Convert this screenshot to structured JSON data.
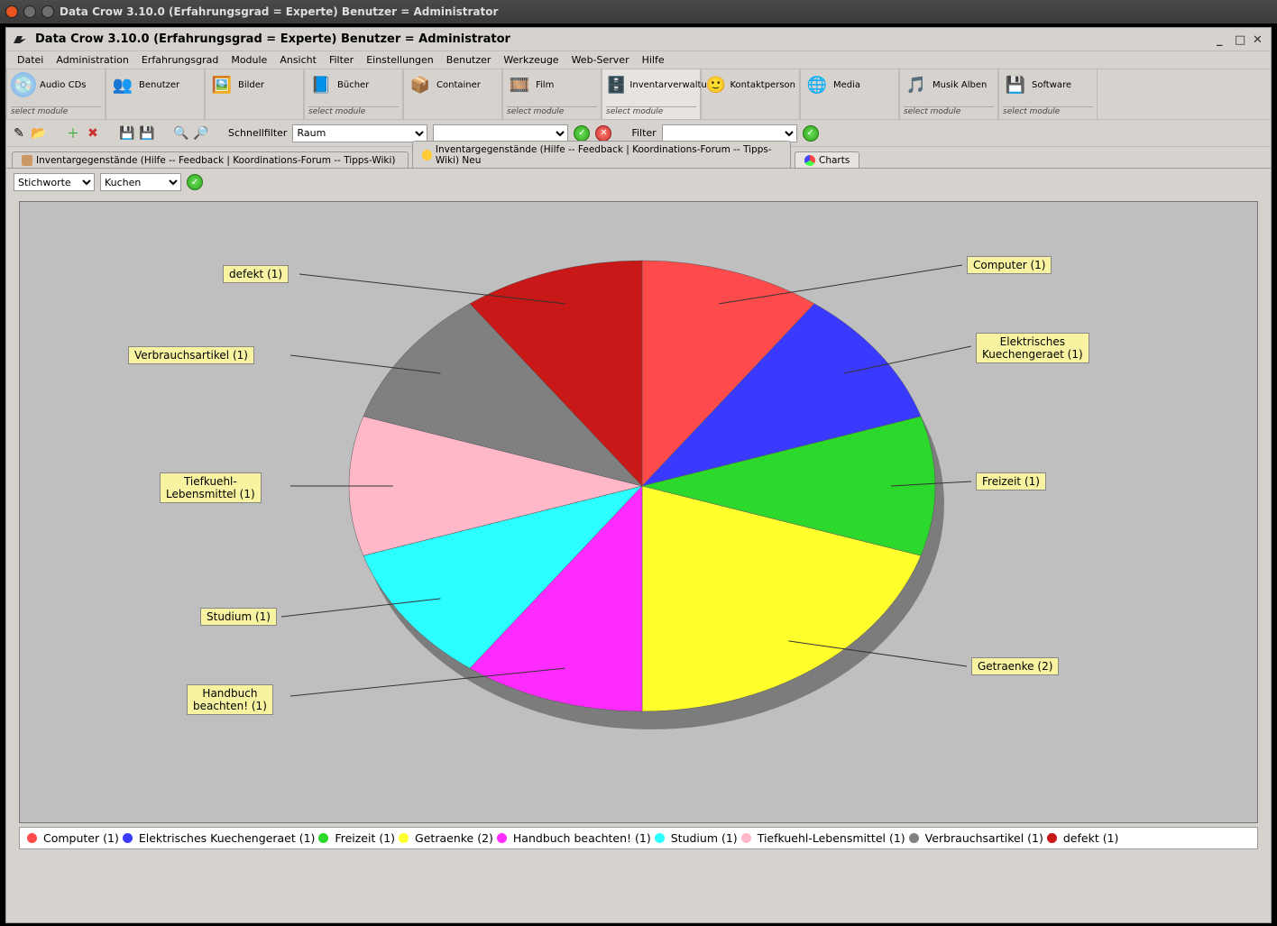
{
  "outer_title": "Data Crow 3.10.0    (Erfahrungsgrad = Experte)   Benutzer = Administrator",
  "inner_title": "Data Crow 3.10.0    (Erfahrungsgrad = Experte)   Benutzer = Administrator",
  "menu": {
    "datei": "Datei",
    "administration": "Administration",
    "erfahrungsgrad": "Erfahrungsgrad",
    "module": "Module",
    "ansicht": "Ansicht",
    "filter": "Filter",
    "einstellungen": "Einstellungen",
    "benutzer": "Benutzer",
    "werkzeuge": "Werkzeuge",
    "webserver": "Web-Server",
    "hilfe": "Hilfe"
  },
  "modules": {
    "select_module": "select module",
    "items": [
      {
        "label": "Audio CDs",
        "select": true
      },
      {
        "label": "Benutzer",
        "select": false
      },
      {
        "label": "Bilder",
        "select": false
      },
      {
        "label": "Bücher",
        "select": true
      },
      {
        "label": "Container",
        "select": false
      },
      {
        "label": "Film",
        "select": true
      },
      {
        "label": "Inventarverwaltung",
        "select": true
      },
      {
        "label": "Kontaktperson",
        "select": false
      },
      {
        "label": "Media",
        "select": false
      },
      {
        "label": "Musik Alben",
        "select": true
      },
      {
        "label": "Software",
        "select": true
      }
    ]
  },
  "toolbar2": {
    "quickfilter_label": "Schnellfilter",
    "quickfilter_field": "Raum",
    "quickfilter_value": "",
    "filter_label": "Filter",
    "filter_value": ""
  },
  "tabs": {
    "t1": "Inventargegenstände (Hilfe -- Feedback  |  Koordinations-Forum -- Tipps-Wiki)",
    "t2": "Inventargegenstände (Hilfe -- Feedback  |  Koordinations-Forum -- Tipps-Wiki) Neu",
    "t3": "Charts"
  },
  "chartctrl": {
    "field1": "Stichworte",
    "field2": "Kuchen"
  },
  "chart_data": {
    "type": "pie",
    "title": "",
    "series": [
      {
        "name": "Computer (1)",
        "value": 1,
        "color": "#ff4b4b"
      },
      {
        "name": "Elektrisches Kuechengeraet (1)",
        "value": 1,
        "color": "#3a3aff"
      },
      {
        "name": "Freizeit (1)",
        "value": 1,
        "color": "#2bd82b"
      },
      {
        "name": "Getraenke (2)",
        "value": 2,
        "color": "#ffff2b"
      },
      {
        "name": "Handbuch beachten! (1)",
        "value": 1,
        "color": "#ff2bff"
      },
      {
        "name": "Studium (1)",
        "value": 1,
        "color": "#2bffff"
      },
      {
        "name": "Tiefkuehl-Lebensmittel (1)",
        "value": 1,
        "color": "#ffb8c8"
      },
      {
        "name": "Verbrauchsartikel (1)",
        "value": 1,
        "color": "#808080"
      },
      {
        "name": "defekt (1)",
        "value": 1,
        "color": "#c81818"
      }
    ],
    "slice_labels": {
      "s0": "Computer (1)",
      "s1": "Elektrisches\nKuechengeraet (1)",
      "s2": "Freizeit (1)",
      "s3": "Getraenke (2)",
      "s4": "Handbuch\nbeachten! (1)",
      "s5": "Studium (1)",
      "s6": "Tiefkuehl-\nLebensmittel (1)",
      "s7": "Verbrauchsartikel (1)",
      "s8": "defekt (1)"
    }
  }
}
